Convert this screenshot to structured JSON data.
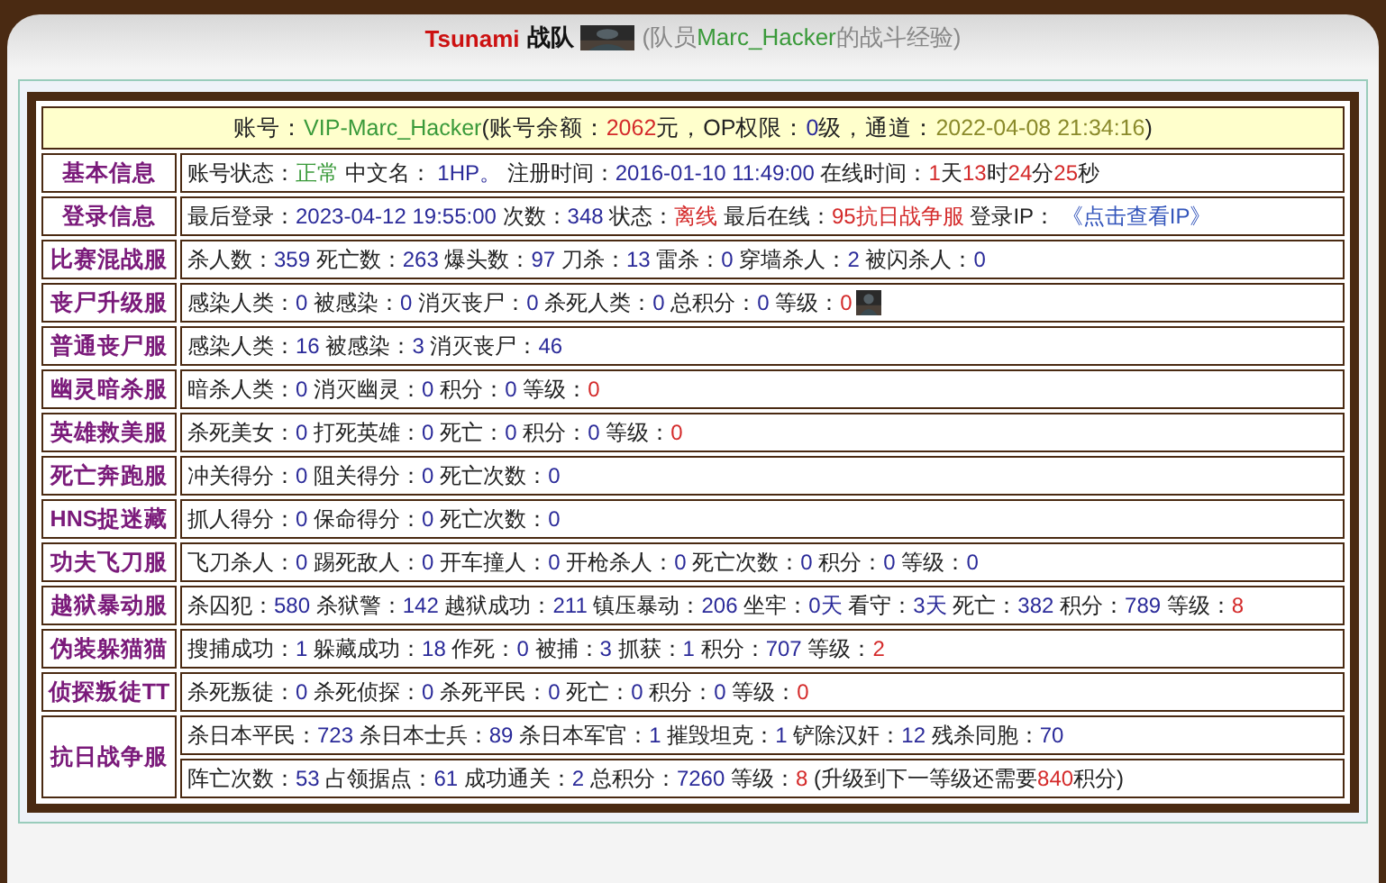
{
  "header": {
    "team": "Tsunami",
    "team_suffix": "战队",
    "member_prefix": "(队员",
    "member": "Marc_Hacker",
    "member_suffix": "的战斗经验)"
  },
  "account": [
    {
      "text": "账号：",
      "color": "#222222"
    },
    {
      "text": "VIP-Marc_Hacker",
      "color": "#3a9a3a"
    },
    {
      "text": "(账号余额：",
      "color": "#222222"
    },
    {
      "text": "2062",
      "color": "#d42a2a"
    },
    {
      "text": "元，OP权限：",
      "color": "#222222"
    },
    {
      "text": "0",
      "color": "#2a2a99"
    },
    {
      "text": "级，通道：",
      "color": "#222222"
    },
    {
      "text": "2022-04-08 21:34:16",
      "color": "#8a8a2a"
    },
    {
      "text": ")",
      "color": "#222222"
    }
  ],
  "rows": [
    {
      "label": "基本信息",
      "lines": [
        {
          "segments": [
            {
              "text": "账号状态：",
              "color": "#222222"
            },
            {
              "text": "正常",
              "color": "#3a9a3a"
            },
            {
              "text": " 中文名： ",
              "color": "#222222"
            },
            {
              "text": "1HP。",
              "color": "#2a2a99"
            },
            {
              "text": " 注册时间：",
              "color": "#222222"
            },
            {
              "text": "2016-01-10 11:49:00",
              "color": "#2a2a99"
            },
            {
              "text": " 在线时间：",
              "color": "#222222"
            },
            {
              "text": "1",
              "color": "#d42a2a"
            },
            {
              "text": "天",
              "color": "#222222"
            },
            {
              "text": "13",
              "color": "#d42a2a"
            },
            {
              "text": "时",
              "color": "#222222"
            },
            {
              "text": "24",
              "color": "#d42a2a"
            },
            {
              "text": "分",
              "color": "#222222"
            },
            {
              "text": "25",
              "color": "#d42a2a"
            },
            {
              "text": "秒",
              "color": "#222222"
            }
          ]
        }
      ]
    },
    {
      "label": "登录信息",
      "lines": [
        {
          "segments": [
            {
              "text": "最后登录：",
              "color": "#222222"
            },
            {
              "text": "2023-04-12 19:55:00",
              "color": "#2a2a99"
            },
            {
              "text": " 次数：",
              "color": "#222222"
            },
            {
              "text": "348",
              "color": "#2a2a99"
            },
            {
              "text": " 状态：",
              "color": "#222222"
            },
            {
              "text": "离线",
              "color": "#d42a2a"
            },
            {
              "text": " 最后在线：",
              "color": "#222222"
            },
            {
              "text": "95抗日战争服",
              "color": "#d42a2a"
            },
            {
              "text": " 登录IP： ",
              "color": "#222222"
            },
            {
              "text": "《点击查看IP》",
              "color": "#3355bb"
            }
          ]
        }
      ]
    },
    {
      "label": "比赛混战服",
      "lines": [
        {
          "segments": [
            {
              "text": "杀人数：",
              "color": "#222222"
            },
            {
              "text": "359",
              "color": "#2a2a99"
            },
            {
              "text": " 死亡数：",
              "color": "#222222"
            },
            {
              "text": "263",
              "color": "#2a2a99"
            },
            {
              "text": " 爆头数：",
              "color": "#222222"
            },
            {
              "text": "97",
              "color": "#2a2a99"
            },
            {
              "text": " 刀杀：",
              "color": "#222222"
            },
            {
              "text": "13",
              "color": "#2a2a99"
            },
            {
              "text": " 雷杀：",
              "color": "#222222"
            },
            {
              "text": "0",
              "color": "#2a2a99"
            },
            {
              "text": " 穿墙杀人：",
              "color": "#222222"
            },
            {
              "text": "2",
              "color": "#2a2a99"
            },
            {
              "text": " 被闪杀人：",
              "color": "#222222"
            },
            {
              "text": "0",
              "color": "#2a2a99"
            }
          ]
        }
      ]
    },
    {
      "label": "丧尸升级服",
      "lines": [
        {
          "segments": [
            {
              "text": "感染人类：",
              "color": "#222222"
            },
            {
              "text": "0",
              "color": "#2a2a99"
            },
            {
              "text": " 被感染：",
              "color": "#222222"
            },
            {
              "text": "0",
              "color": "#2a2a99"
            },
            {
              "text": " 消灭丧尸：",
              "color": "#222222"
            },
            {
              "text": "0",
              "color": "#2a2a99"
            },
            {
              "text": " 杀死人类：",
              "color": "#222222"
            },
            {
              "text": "0",
              "color": "#2a2a99"
            },
            {
              "text": " 总积分：",
              "color": "#222222"
            },
            {
              "text": "0",
              "color": "#2a2a99"
            },
            {
              "text": " 等级：",
              "color": "#222222"
            },
            {
              "text": "0",
              "color": "#d42a2a"
            }
          ],
          "avatar": true
        }
      ]
    },
    {
      "label": "普通丧尸服",
      "lines": [
        {
          "segments": [
            {
              "text": "感染人类：",
              "color": "#222222"
            },
            {
              "text": "16",
              "color": "#2a2a99"
            },
            {
              "text": " 被感染：",
              "color": "#222222"
            },
            {
              "text": "3",
              "color": "#2a2a99"
            },
            {
              "text": " 消灭丧尸：",
              "color": "#222222"
            },
            {
              "text": "46",
              "color": "#2a2a99"
            }
          ]
        }
      ]
    },
    {
      "label": "幽灵暗杀服",
      "lines": [
        {
          "segments": [
            {
              "text": "暗杀人类：",
              "color": "#222222"
            },
            {
              "text": "0",
              "color": "#2a2a99"
            },
            {
              "text": " 消灭幽灵：",
              "color": "#222222"
            },
            {
              "text": "0",
              "color": "#2a2a99"
            },
            {
              "text": " 积分：",
              "color": "#222222"
            },
            {
              "text": "0",
              "color": "#2a2a99"
            },
            {
              "text": " 等级：",
              "color": "#222222"
            },
            {
              "text": "0",
              "color": "#d42a2a"
            }
          ]
        }
      ]
    },
    {
      "label": "英雄救美服",
      "lines": [
        {
          "segments": [
            {
              "text": "杀死美女：",
              "color": "#222222"
            },
            {
              "text": "0",
              "color": "#2a2a99"
            },
            {
              "text": " 打死英雄：",
              "color": "#222222"
            },
            {
              "text": "0",
              "color": "#2a2a99"
            },
            {
              "text": " 死亡：",
              "color": "#222222"
            },
            {
              "text": "0",
              "color": "#2a2a99"
            },
            {
              "text": " 积分：",
              "color": "#222222"
            },
            {
              "text": "0",
              "color": "#2a2a99"
            },
            {
              "text": " 等级：",
              "color": "#222222"
            },
            {
              "text": "0",
              "color": "#d42a2a"
            }
          ]
        }
      ]
    },
    {
      "label": "死亡奔跑服",
      "lines": [
        {
          "segments": [
            {
              "text": "冲关得分：",
              "color": "#222222"
            },
            {
              "text": "0",
              "color": "#2a2a99"
            },
            {
              "text": " 阻关得分：",
              "color": "#222222"
            },
            {
              "text": "0",
              "color": "#2a2a99"
            },
            {
              "text": " 死亡次数：",
              "color": "#222222"
            },
            {
              "text": "0",
              "color": "#2a2a99"
            }
          ]
        }
      ]
    },
    {
      "label": "HNS捉迷藏",
      "lines": [
        {
          "segments": [
            {
              "text": "抓人得分：",
              "color": "#222222"
            },
            {
              "text": "0",
              "color": "#2a2a99"
            },
            {
              "text": " 保命得分：",
              "color": "#222222"
            },
            {
              "text": "0",
              "color": "#2a2a99"
            },
            {
              "text": " 死亡次数：",
              "color": "#222222"
            },
            {
              "text": "0",
              "color": "#2a2a99"
            }
          ]
        }
      ]
    },
    {
      "label": "功夫飞刀服",
      "lines": [
        {
          "segments": [
            {
              "text": "飞刀杀人：",
              "color": "#222222"
            },
            {
              "text": "0",
              "color": "#2a2a99"
            },
            {
              "text": " 踢死敌人：",
              "color": "#222222"
            },
            {
              "text": "0",
              "color": "#2a2a99"
            },
            {
              "text": " 开车撞人：",
              "color": "#222222"
            },
            {
              "text": "0",
              "color": "#2a2a99"
            },
            {
              "text": " 开枪杀人：",
              "color": "#222222"
            },
            {
              "text": "0",
              "color": "#2a2a99"
            },
            {
              "text": " 死亡次数：",
              "color": "#222222"
            },
            {
              "text": "0",
              "color": "#2a2a99"
            },
            {
              "text": " 积分：",
              "color": "#222222"
            },
            {
              "text": "0",
              "color": "#2a2a99"
            },
            {
              "text": " 等级：",
              "color": "#222222"
            },
            {
              "text": "0",
              "color": "#2a2a99"
            }
          ]
        }
      ]
    },
    {
      "label": "越狱暴动服",
      "lines": [
        {
          "segments": [
            {
              "text": "杀囚犯：",
              "color": "#222222"
            },
            {
              "text": "580",
              "color": "#2a2a99"
            },
            {
              "text": " 杀狱警：",
              "color": "#222222"
            },
            {
              "text": "142",
              "color": "#2a2a99"
            },
            {
              "text": " 越狱成功：",
              "color": "#222222"
            },
            {
              "text": "211",
              "color": "#2a2a99"
            },
            {
              "text": " 镇压暴动：",
              "color": "#222222"
            },
            {
              "text": "206",
              "color": "#2a2a99"
            },
            {
              "text": " 坐牢：",
              "color": "#222222"
            },
            {
              "text": "0天",
              "color": "#2a2a99"
            },
            {
              "text": " 看守：",
              "color": "#222222"
            },
            {
              "text": "3天",
              "color": "#2a2a99"
            },
            {
              "text": " 死亡：",
              "color": "#222222"
            },
            {
              "text": "382",
              "color": "#2a2a99"
            },
            {
              "text": " 积分：",
              "color": "#222222"
            },
            {
              "text": "789",
              "color": "#2a2a99"
            },
            {
              "text": " 等级：",
              "color": "#222222"
            },
            {
              "text": "8",
              "color": "#d42a2a"
            }
          ]
        }
      ]
    },
    {
      "label": "伪装躲猫猫",
      "lines": [
        {
          "segments": [
            {
              "text": "搜捕成功：",
              "color": "#222222"
            },
            {
              "text": "1",
              "color": "#2a2a99"
            },
            {
              "text": " 躲藏成功：",
              "color": "#222222"
            },
            {
              "text": "18",
              "color": "#2a2a99"
            },
            {
              "text": " 作死：",
              "color": "#222222"
            },
            {
              "text": "0",
              "color": "#2a2a99"
            },
            {
              "text": " 被捕：",
              "color": "#222222"
            },
            {
              "text": "3",
              "color": "#2a2a99"
            },
            {
              "text": " 抓获：",
              "color": "#222222"
            },
            {
              "text": "1",
              "color": "#2a2a99"
            },
            {
              "text": " 积分：",
              "color": "#222222"
            },
            {
              "text": "707",
              "color": "#2a2a99"
            },
            {
              "text": " 等级：",
              "color": "#222222"
            },
            {
              "text": "2",
              "color": "#d42a2a"
            }
          ]
        }
      ]
    },
    {
      "label": "侦探叛徒TT",
      "lines": [
        {
          "segments": [
            {
              "text": "杀死叛徒：",
              "color": "#222222"
            },
            {
              "text": "0",
              "color": "#2a2a99"
            },
            {
              "text": " 杀死侦探：",
              "color": "#222222"
            },
            {
              "text": "0",
              "color": "#2a2a99"
            },
            {
              "text": " 杀死平民：",
              "color": "#222222"
            },
            {
              "text": "0",
              "color": "#2a2a99"
            },
            {
              "text": " 死亡：",
              "color": "#222222"
            },
            {
              "text": "0",
              "color": "#2a2a99"
            },
            {
              "text": " 积分：",
              "color": "#222222"
            },
            {
              "text": "0",
              "color": "#2a2a99"
            },
            {
              "text": " 等级：",
              "color": "#222222"
            },
            {
              "text": "0",
              "color": "#d42a2a"
            }
          ]
        }
      ]
    },
    {
      "label": "抗日战争服",
      "lines": [
        {
          "segments": [
            {
              "text": "杀日本平民：",
              "color": "#222222"
            },
            {
              "text": "723",
              "color": "#2a2a99"
            },
            {
              "text": " 杀日本士兵：",
              "color": "#222222"
            },
            {
              "text": "89",
              "color": "#2a2a99"
            },
            {
              "text": " 杀日本军官：",
              "color": "#222222"
            },
            {
              "text": "1",
              "color": "#2a2a99"
            },
            {
              "text": " 摧毁坦克：",
              "color": "#222222"
            },
            {
              "text": "1",
              "color": "#2a2a99"
            },
            {
              "text": " 铲除汉奸：",
              "color": "#222222"
            },
            {
              "text": "12",
              "color": "#2a2a99"
            },
            {
              "text": " 残杀同胞：",
              "color": "#222222"
            },
            {
              "text": "70",
              "color": "#2a2a99"
            }
          ]
        },
        {
          "segments": [
            {
              "text": "阵亡次数：",
              "color": "#222222"
            },
            {
              "text": "53",
              "color": "#2a2a99"
            },
            {
              "text": " 占领据点：",
              "color": "#222222"
            },
            {
              "text": "61",
              "color": "#2a2a99"
            },
            {
              "text": " 成功通关：",
              "color": "#222222"
            },
            {
              "text": "2",
              "color": "#2a2a99"
            },
            {
              "text": " 总积分：",
              "color": "#222222"
            },
            {
              "text": "7260",
              "color": "#2a2a99"
            },
            {
              "text": " 等级：",
              "color": "#222222"
            },
            {
              "text": "8",
              "color": "#d42a2a"
            },
            {
              "text": " (升级到下一等级还需要",
              "color": "#222222"
            },
            {
              "text": "840",
              "color": "#d42a2a"
            },
            {
              "text": "积分)",
              "color": "#222222"
            }
          ]
        }
      ]
    }
  ]
}
